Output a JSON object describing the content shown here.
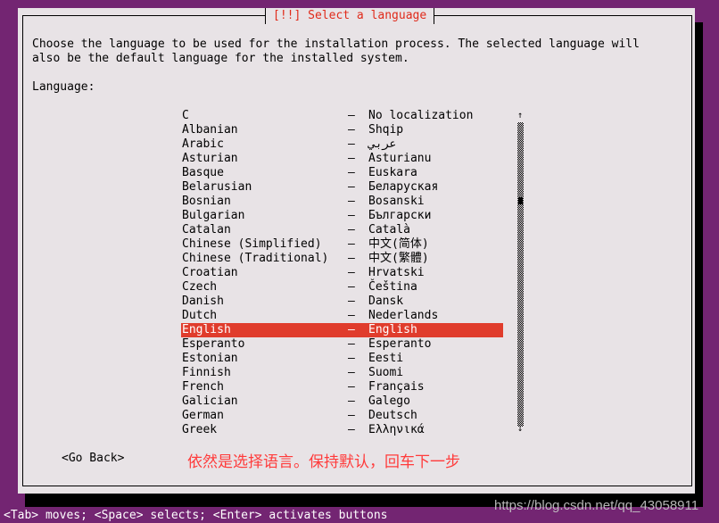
{
  "dialog": {
    "title": "[!!] Select a language",
    "description_line1": "Choose the language to be used for the installation process. The selected language will",
    "description_line2": "also be the default language for the installed system.",
    "field_label": "Language:",
    "selected": "English",
    "languages": [
      [
        "C",
        "No localization"
      ],
      [
        "Albanian",
        "Shqip"
      ],
      [
        "Arabic",
        "عربي"
      ],
      [
        "Asturian",
        "Asturianu"
      ],
      [
        "Basque",
        "Euskara"
      ],
      [
        "Belarusian",
        "Беларуская"
      ],
      [
        "Bosnian",
        "Bosanski"
      ],
      [
        "Bulgarian",
        "Български"
      ],
      [
        "Catalan",
        "Català"
      ],
      [
        "Chinese (Simplified)",
        "中文(简体)"
      ],
      [
        "Chinese (Traditional)",
        "中文(繁體)"
      ],
      [
        "Croatian",
        "Hrvatski"
      ],
      [
        "Czech",
        "Čeština"
      ],
      [
        "Danish",
        "Dansk"
      ],
      [
        "Dutch",
        "Nederlands"
      ],
      [
        "English",
        "English"
      ],
      [
        "Esperanto",
        "Esperanto"
      ],
      [
        "Estonian",
        "Eesti"
      ],
      [
        "Finnish",
        "Suomi"
      ],
      [
        "French",
        "Français"
      ],
      [
        "Galician",
        "Galego"
      ],
      [
        "German",
        "Deutsch"
      ],
      [
        "Greek",
        "Ελληνικά"
      ]
    ],
    "separator": "–",
    "go_back": "<Go Back>",
    "scroll_up": "↑",
    "scroll_down": "↓"
  },
  "annotation": "依然是选择语言。保持默认，回车下一步",
  "footer": "<Tab> moves; <Space> selects; <Enter> activates buttons",
  "watermark": "https://blog.csdn.net/qq_43058911",
  "colors": {
    "background": "#732572",
    "dialog": "#e8e3e6",
    "title": "#e02a1a",
    "highlight": "#e03c2c",
    "annotation": "#ff3b3b"
  }
}
